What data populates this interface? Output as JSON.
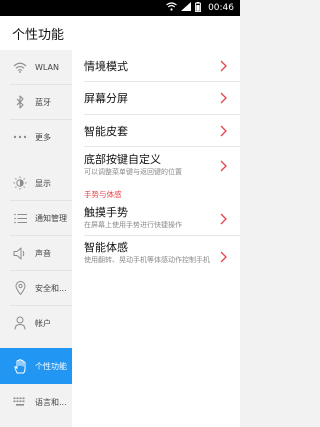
{
  "status_bar": {
    "time": "00:46",
    "icons": [
      "wifi-icon",
      "signal-icon",
      "battery-icon"
    ]
  },
  "app_bar": {
    "title": "个性功能"
  },
  "sidebar": {
    "items": [
      {
        "label": "WLAN",
        "icon": "wifi-icon"
      },
      {
        "label": "蓝牙",
        "icon": "bluetooth-icon"
      },
      {
        "label": "更多",
        "icon": "more-dots-icon"
      },
      {
        "label": "显示",
        "icon": "brightness-icon"
      },
      {
        "label": "通知管理",
        "icon": "notification-list-icon"
      },
      {
        "label": "声音",
        "icon": "speaker-icon"
      },
      {
        "label": "安全和...",
        "icon": "location-pin-icon"
      },
      {
        "label": "帐户",
        "icon": "person-icon"
      },
      {
        "label": "个性功能",
        "icon": "hand-icon",
        "active": true
      },
      {
        "label": "语言和...",
        "icon": "keyboard-icon"
      }
    ]
  },
  "settings": {
    "items": [
      {
        "title": "情境模式"
      },
      {
        "title": "屏幕分屏"
      },
      {
        "title": "智能皮套"
      },
      {
        "title": "底部按键自定义",
        "subtitle": "可以调整菜单键与返回键的位置"
      },
      {
        "title": "触摸手势",
        "subtitle": "在屏幕上使用手势进行快捷操作"
      },
      {
        "title": "智能体感",
        "subtitle": "使用翻转、晃动手机等体感动作控制手机"
      }
    ],
    "section_header": "手势与体感"
  },
  "colors": {
    "accent": "#2196f3",
    "chevron": "#e8404a",
    "section_header": "#e8404a"
  }
}
